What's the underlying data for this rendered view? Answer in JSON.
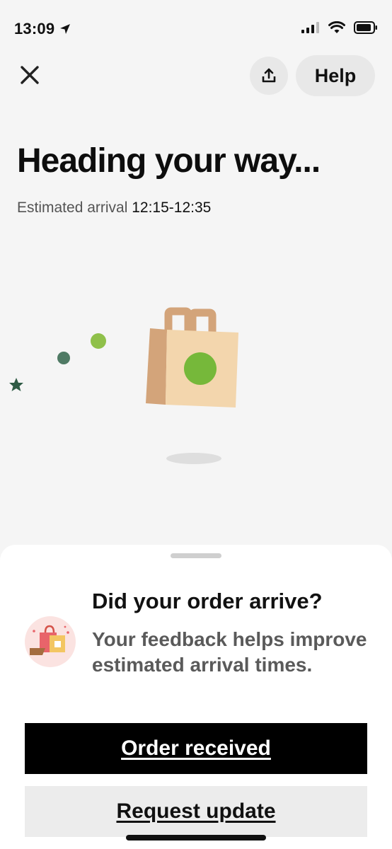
{
  "status_bar": {
    "time": "13:09"
  },
  "header": {
    "help_label": "Help"
  },
  "main": {
    "title": "Heading your way...",
    "eta_label": "Estimated arrival",
    "eta_value": "12:15-12:35"
  },
  "sheet": {
    "title": "Did your order arrive?",
    "body": "Your feedback helps improve estimated arrival times.",
    "primary_button": "Order received",
    "secondary_button": "Request update"
  },
  "icons": {
    "location": "location-arrow-icon",
    "signal": "cellular-signal-icon",
    "wifi": "wifi-icon",
    "battery": "battery-icon",
    "close": "close-icon",
    "share": "share-icon"
  },
  "colors": {
    "background": "#f5f5f5",
    "primary_button": "#000000",
    "secondary_button": "#ececec",
    "bag": "#f3d6ad",
    "bag_side": "#d3a47a",
    "bag_dot": "#76b83a"
  }
}
